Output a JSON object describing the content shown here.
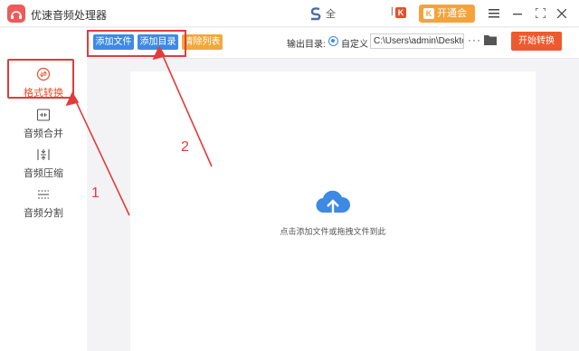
{
  "app": {
    "title": "优速音频处理器"
  },
  "titlebar": {
    "s_logo_text": "全",
    "k_badge": "K",
    "vip_label": "开通会员",
    "vip_icon": "K",
    "controls": [
      "menu-icon",
      "minimize-icon",
      "maximize-icon",
      "close-icon"
    ]
  },
  "sidebar": {
    "items": [
      {
        "label": "格式转换",
        "icon": "convert-icon",
        "active": true
      },
      {
        "label": "音频合并",
        "icon": "merge-icon",
        "active": false
      },
      {
        "label": "音频压缩",
        "icon": "compress-icon",
        "active": false
      },
      {
        "label": "音频分割",
        "icon": "split-icon",
        "active": false
      }
    ]
  },
  "toolbar": {
    "add_file": "添加文件",
    "add_dir": "添加目录",
    "clear_list": "清除列表",
    "output_label": "输出目录:",
    "radio_label": "自定义",
    "path_value": "C:\\Users\\admin\\Desktop",
    "more": "···",
    "start": "开始转换"
  },
  "main": {
    "drop_hint": "点击添加文件或拖拽文件到此"
  },
  "annotations": {
    "n1": "1",
    "n2": "2"
  },
  "colors": {
    "accent": "#3d8ae5",
    "brand_red": "#e94e2a",
    "orange": "#f2a73a",
    "annotation": "#e33b3b"
  }
}
